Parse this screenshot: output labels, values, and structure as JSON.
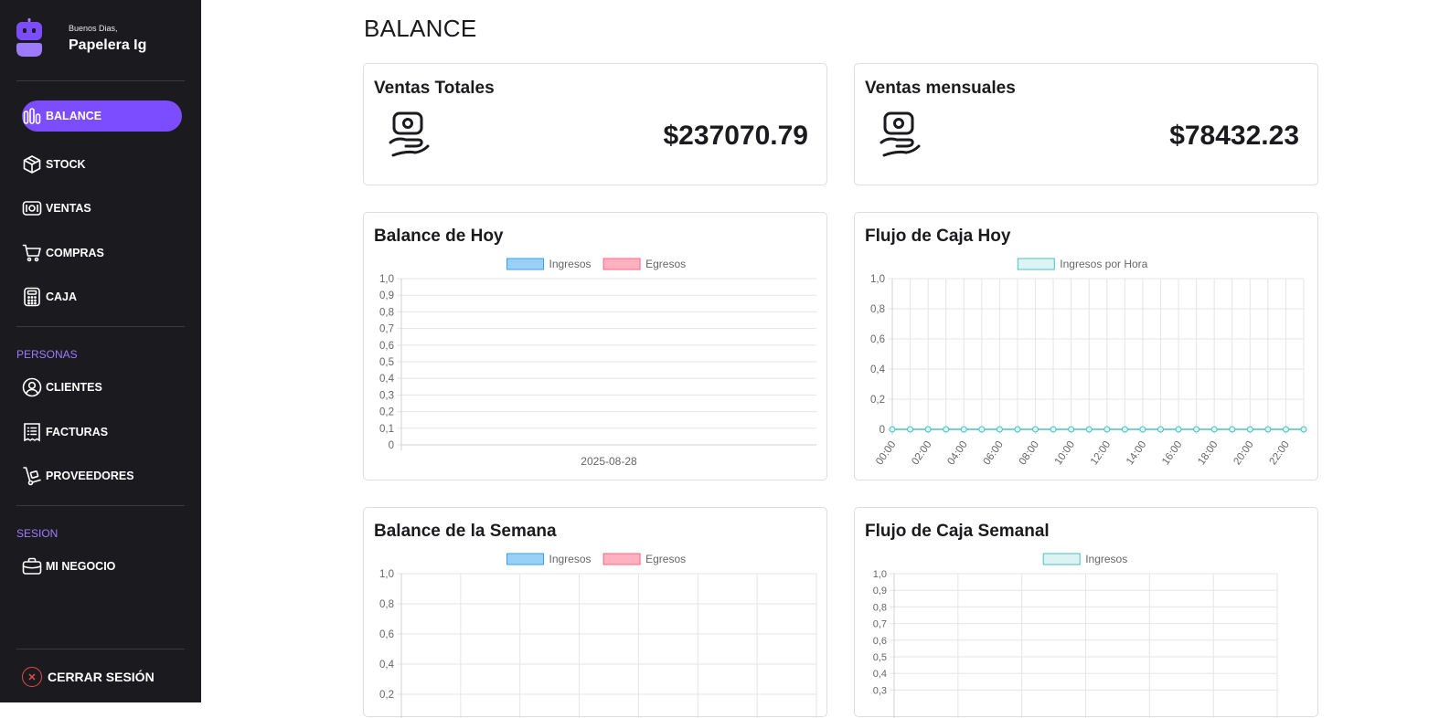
{
  "user": {
    "greeting": "Buenos Dias,",
    "name": "Papelera Ig"
  },
  "nav": {
    "main": [
      {
        "key": "balance",
        "label": "BALANCE",
        "icon": "bar-chart-icon",
        "active": true
      },
      {
        "key": "stock",
        "label": "STOCK",
        "icon": "box-icon",
        "active": false
      },
      {
        "key": "ventas",
        "label": "VENTAS",
        "icon": "banknote-icon",
        "active": false
      },
      {
        "key": "compras",
        "label": "COMPRAS",
        "icon": "cart-icon",
        "active": false
      },
      {
        "key": "caja",
        "label": "CAJA",
        "icon": "calculator-icon",
        "active": false
      }
    ],
    "personas_label": "PERSONAS",
    "personas": [
      {
        "key": "clientes",
        "label": "CLIENTES",
        "icon": "user-circle-icon"
      },
      {
        "key": "facturas",
        "label": "FACTURAS",
        "icon": "receipt-icon"
      },
      {
        "key": "proveedores",
        "label": "PROVEEDORES",
        "icon": "hand-truck-icon"
      }
    ],
    "sesion_label": "SESION",
    "sesion": [
      {
        "key": "mi_negocio",
        "label": "MI NEGOCIO",
        "icon": "briefcase-icon"
      }
    ],
    "logout_label": "CERRAR SESIÓN"
  },
  "page": {
    "title": "BALANCE"
  },
  "stats": {
    "ventas_totales": {
      "title": "Ventas Totales",
      "value": "$237070.79"
    },
    "ventas_mensuales": {
      "title": "Ventas mensuales",
      "value": "$78432.23"
    }
  },
  "colors": {
    "accent": "#7c4dff",
    "sidebar_bg": "#1b1b1f",
    "ingresos_fill": "#9ad0f5",
    "ingresos_stroke": "#36a2eb",
    "egresos_fill": "#ffb1c1",
    "egresos_stroke": "#ff6384",
    "teal_fill": "#dcf3f3",
    "teal_stroke": "#4bc0c0"
  },
  "chart_data": [
    {
      "id": "balance_hoy",
      "title": "Balance de Hoy",
      "type": "bar",
      "categories": [
        "2025-08-28"
      ],
      "series": [
        {
          "name": "Ingresos",
          "values": [
            0
          ]
        },
        {
          "name": "Egresos",
          "values": [
            0
          ]
        }
      ],
      "ylim": [
        0,
        1.0
      ],
      "yticks": [
        "1,0",
        "0,9",
        "0,8",
        "0,7",
        "0,6",
        "0,5",
        "0,4",
        "0,3",
        "0,2",
        "0,1",
        "0"
      ],
      "grid": true,
      "legend": "top-center"
    },
    {
      "id": "flujo_caja_hoy",
      "title": "Flujo de Caja Hoy",
      "type": "line",
      "categories": [
        "00:00",
        "01:00",
        "02:00",
        "03:00",
        "04:00",
        "05:00",
        "06:00",
        "07:00",
        "08:00",
        "09:00",
        "10:00",
        "11:00",
        "12:00",
        "13:00",
        "14:00",
        "15:00",
        "16:00",
        "17:00",
        "18:00",
        "19:00",
        "20:00",
        "21:00",
        "22:00",
        "23:00"
      ],
      "xtick_labels": [
        "00:00",
        "02:00",
        "04:00",
        "06:00",
        "08:00",
        "10:00",
        "12:00",
        "14:00",
        "16:00",
        "18:00",
        "20:00",
        "22:00"
      ],
      "series": [
        {
          "name": "Ingresos por Hora",
          "values": [
            0,
            0,
            0,
            0,
            0,
            0,
            0,
            0,
            0,
            0,
            0,
            0,
            0,
            0,
            0,
            0,
            0,
            0,
            0,
            0,
            0,
            0,
            0,
            0
          ]
        }
      ],
      "ylim": [
        0,
        1.0
      ],
      "yticks": [
        "1,0",
        "0,8",
        "0,6",
        "0,4",
        "0,2",
        "0"
      ],
      "grid": true,
      "legend": "top-center"
    },
    {
      "id": "balance_semana",
      "title": "Balance de la Semana",
      "type": "bar",
      "series": [
        {
          "name": "Ingresos",
          "values": []
        },
        {
          "name": "Egresos",
          "values": []
        }
      ],
      "ylim": [
        0,
        1.0
      ],
      "yticks": [
        "1,0",
        "0,8",
        "0,6",
        "0,4",
        "0,2"
      ],
      "grid": true,
      "legend": "top-center"
    },
    {
      "id": "flujo_caja_semanal",
      "title": "Flujo de Caja Semanal",
      "type": "line",
      "series": [
        {
          "name": "Ingresos",
          "values": []
        }
      ],
      "ylim": [
        0,
        1.0
      ],
      "yticks": [
        "1,0",
        "0,9",
        "0,8",
        "0,7",
        "0,6",
        "0,5",
        "0,4",
        "0,3"
      ],
      "grid": true,
      "legend": "top-center"
    }
  ]
}
